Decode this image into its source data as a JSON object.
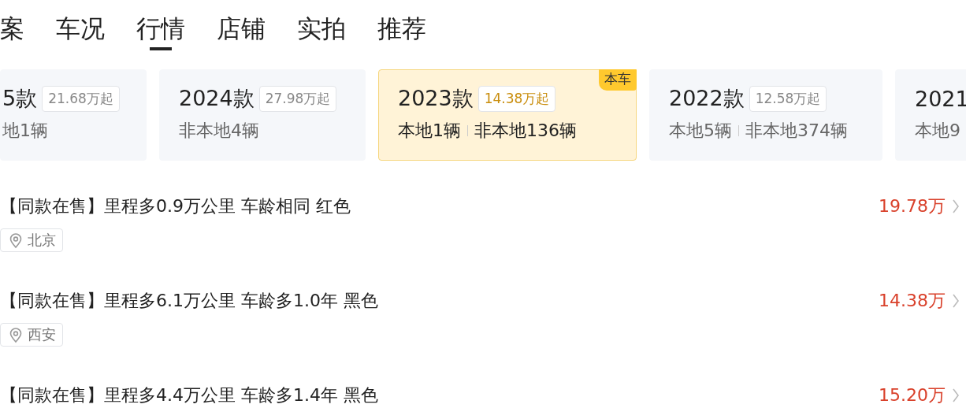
{
  "tabs": [
    {
      "label": "案",
      "selected": false
    },
    {
      "label": "车况",
      "selected": false
    },
    {
      "label": "行情",
      "selected": true
    },
    {
      "label": "店铺",
      "selected": false
    },
    {
      "label": "实拍",
      "selected": false
    },
    {
      "label": "推荐",
      "selected": false
    }
  ],
  "year_cards": [
    {
      "year": "5款",
      "price": "21.68万起",
      "counts": [
        "地1辆"
      ],
      "selected": false
    },
    {
      "year": "2024款",
      "price": "27.98万起",
      "counts": [
        "非本地4辆"
      ],
      "selected": false
    },
    {
      "year": "2023款",
      "price": "14.38万起",
      "counts": [
        "本地1辆",
        "非本地136辆"
      ],
      "selected": true,
      "badge": "本车"
    },
    {
      "year": "2022款",
      "price": "12.58万起",
      "counts": [
        "本地5辆",
        "非本地374辆"
      ],
      "selected": false
    },
    {
      "year": "2021",
      "counts": [
        "本地9"
      ],
      "selected": false
    }
  ],
  "listings": [
    {
      "title": "【同款在售】里程多0.9万公里 车龄相同 红色",
      "price": "19.78万",
      "location": "北京"
    },
    {
      "title": "【同款在售】里程多6.1万公里 车龄多1.0年 黑色",
      "price": "14.38万",
      "location": "西安"
    },
    {
      "title": "【同款在售】里程多4.4万公里 车龄多1.4年 黑色",
      "price": "15.20万"
    }
  ]
}
